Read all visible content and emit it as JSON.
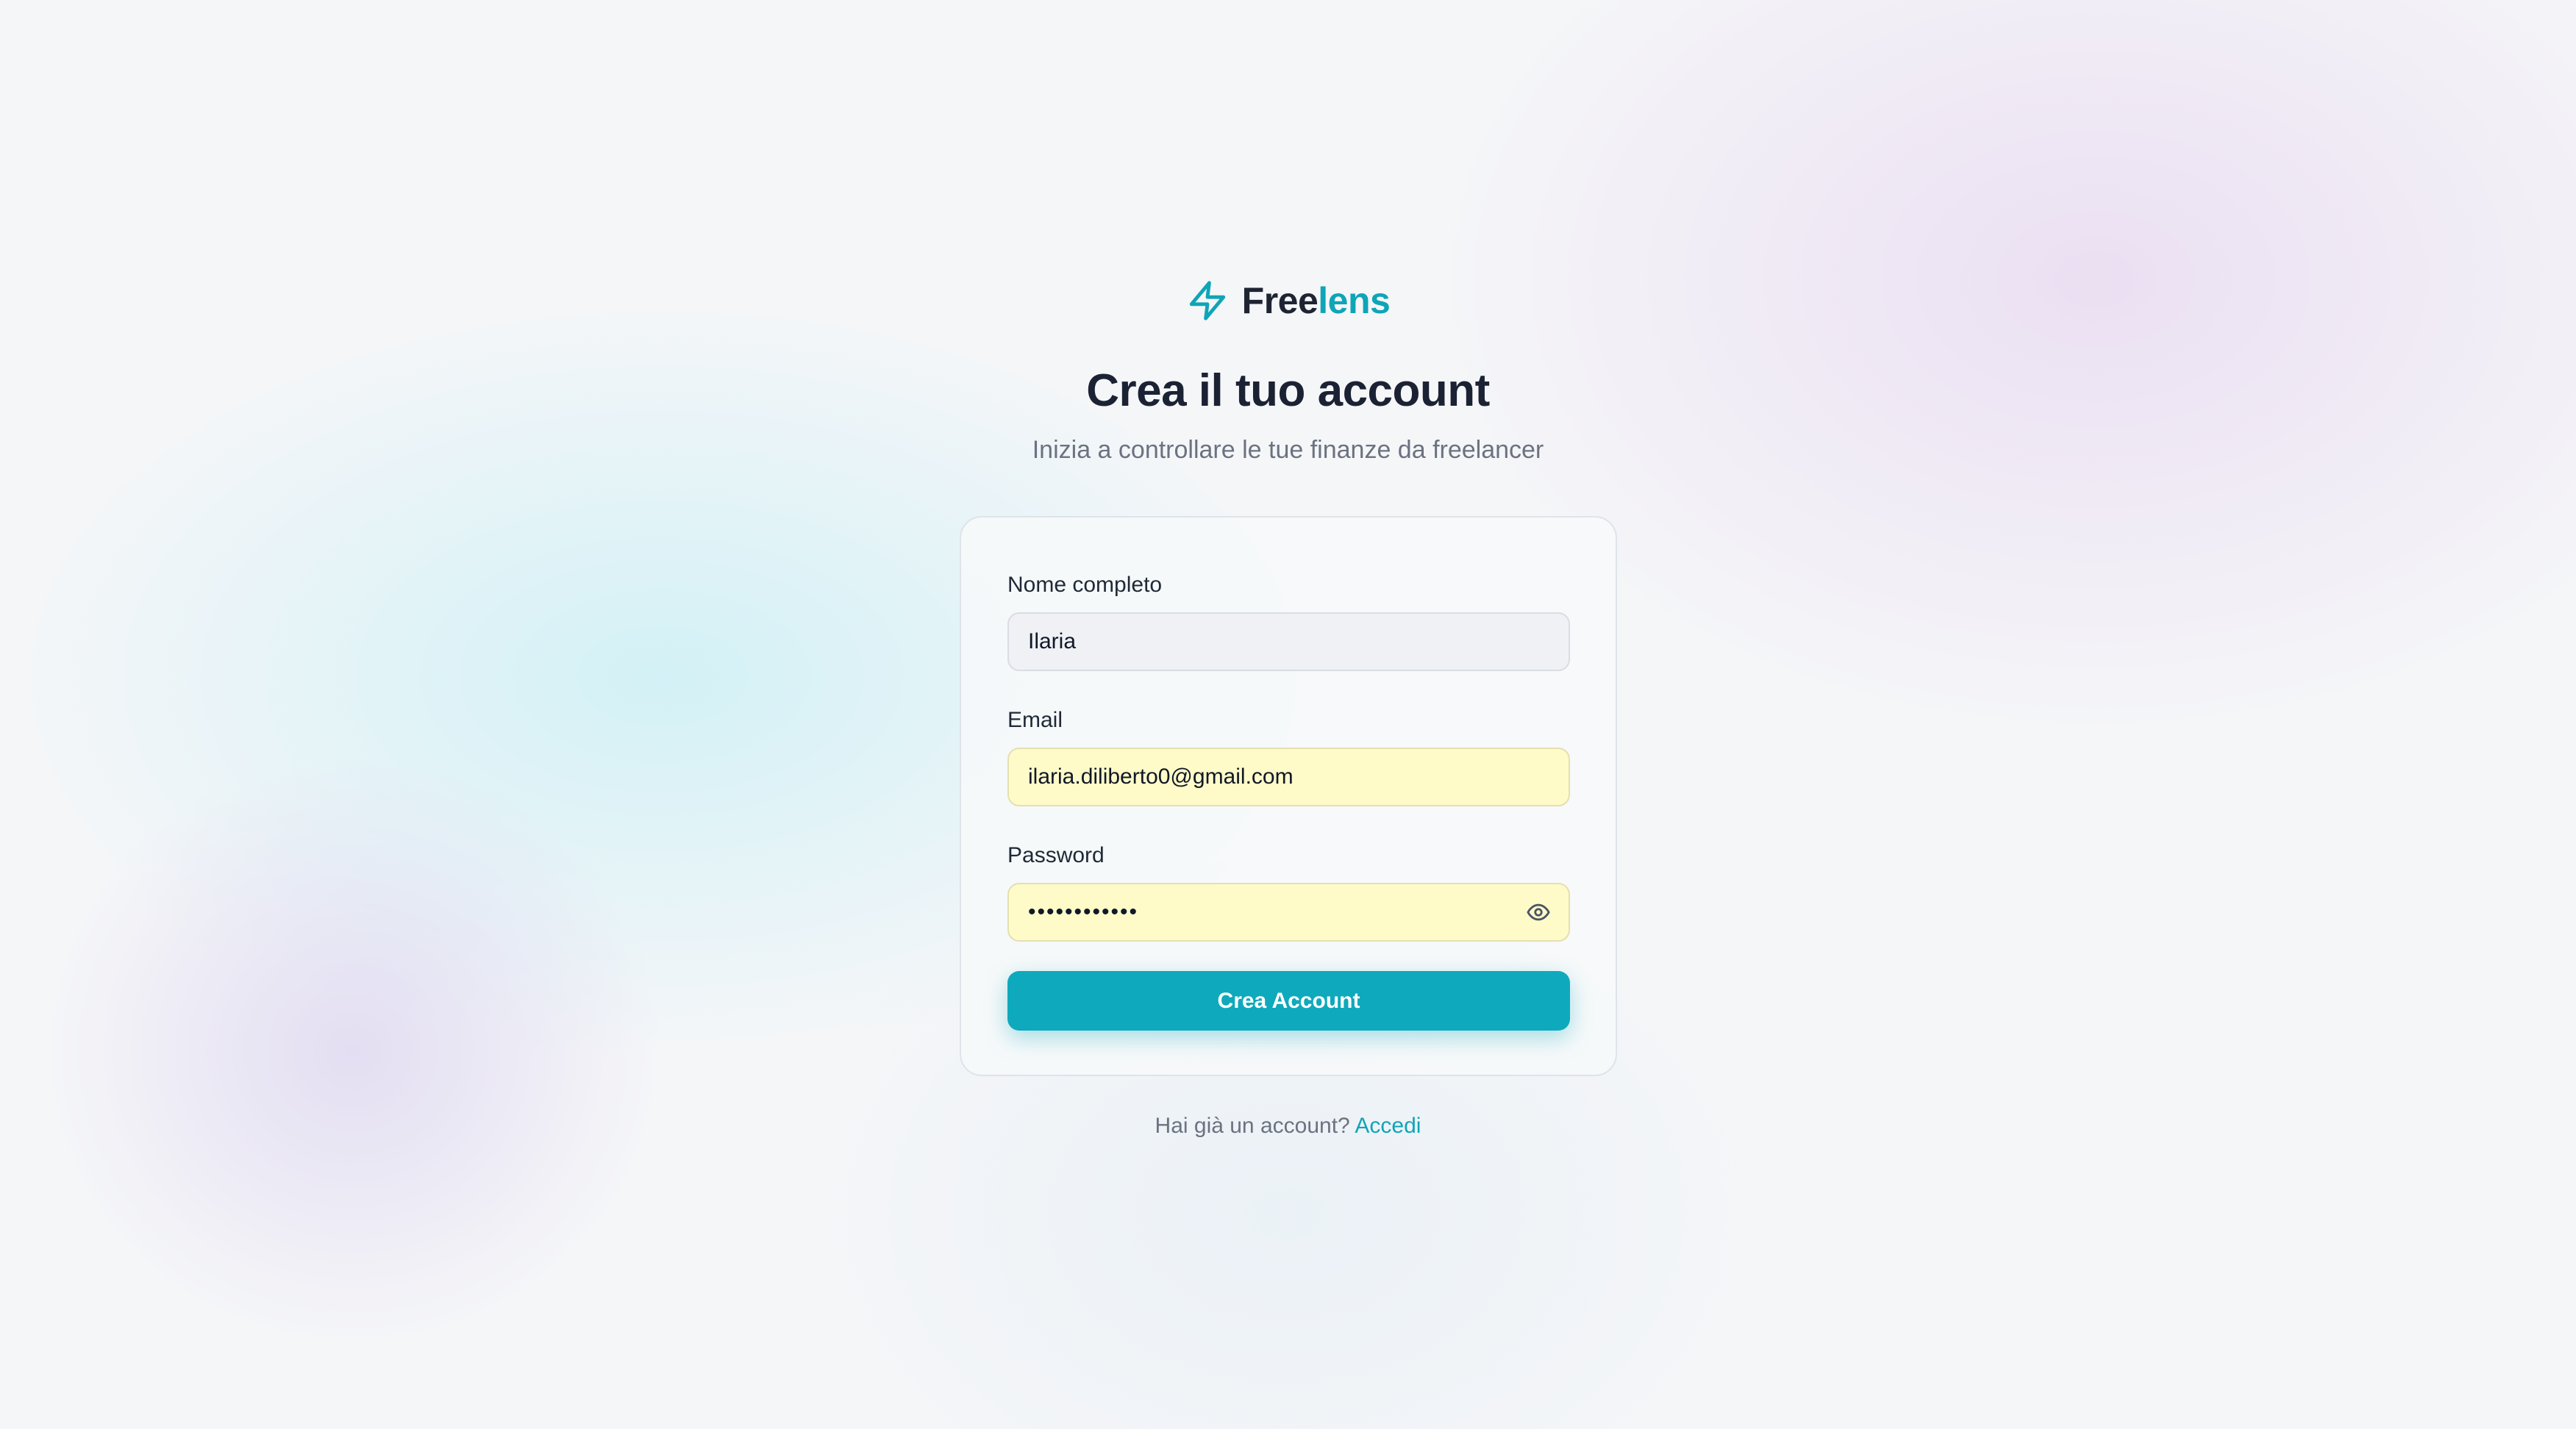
{
  "brand": {
    "name_part1": "Free",
    "name_part2": "lens",
    "icon": "lightning-bolt-icon",
    "accent_color": "#0ea5b7"
  },
  "header": {
    "title": "Crea il tuo account",
    "subtitle": "Inizia a controllare le tue finanze da freelancer"
  },
  "form": {
    "name": {
      "label": "Nome completo",
      "value": "Ilaria"
    },
    "email": {
      "label": "Email",
      "value": "ilaria.diliberto0@gmail.com"
    },
    "password": {
      "label": "Password",
      "value": "••••••••••••",
      "toggle_icon": "eye-icon"
    },
    "submit_label": "Crea Account"
  },
  "footer": {
    "prompt": "Hai già un account?",
    "link_label": "Accedi"
  },
  "colors": {
    "primary_button": "#0ea9bc",
    "autofill_background": "#fefbc9",
    "title_text": "#1b2233"
  }
}
